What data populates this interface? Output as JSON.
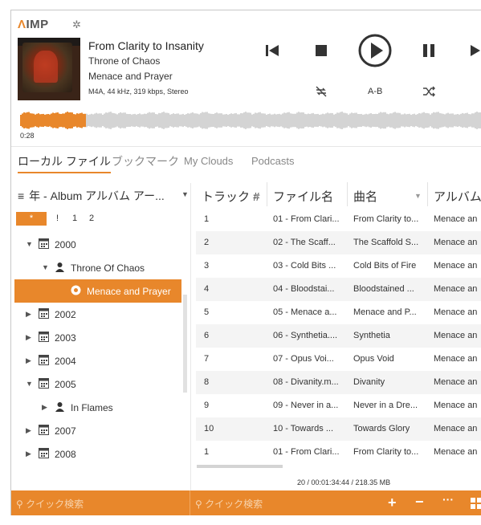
{
  "app": {
    "logo_prefix": "Λ",
    "logo_rest": "IMP"
  },
  "now_playing": {
    "title": "From Clarity to Insanity",
    "artist": "Throne of Chaos",
    "album": "Menace and Prayer",
    "format": "M4A, 44 kHz, 319 kbps, Stereo",
    "position": "0:28",
    "ab_label": "A-B",
    "progress": 0.14
  },
  "tabs": [
    "ローカル ファイル",
    "ブックマーク",
    "My Clouds",
    "Podcasts"
  ],
  "left_panel": {
    "grouping_label": "年 - Album アルバム アー...",
    "alpha": [
      "*",
      "!",
      "1",
      "2"
    ],
    "tree": [
      {
        "label": "2000",
        "type": "year",
        "expanded": true,
        "level": 0
      },
      {
        "label": "Throne Of Chaos",
        "type": "artist",
        "expanded": true,
        "level": 1
      },
      {
        "label": "Menace and Prayer",
        "type": "album",
        "selected": true,
        "level": 2
      },
      {
        "label": "2002",
        "type": "year",
        "expanded": false,
        "level": 0
      },
      {
        "label": "2003",
        "type": "year",
        "expanded": false,
        "level": 0
      },
      {
        "label": "2004",
        "type": "year",
        "expanded": false,
        "level": 0
      },
      {
        "label": "2005",
        "type": "year",
        "expanded": true,
        "level": 0
      },
      {
        "label": "In Flames",
        "type": "artist",
        "expanded": false,
        "level": 1
      },
      {
        "label": "2007",
        "type": "year",
        "expanded": false,
        "level": 0
      },
      {
        "label": "2008",
        "type": "year",
        "expanded": false,
        "level": 0
      }
    ]
  },
  "table": {
    "columns": [
      "トラック #",
      "ファイル名",
      "曲名",
      "アルバム"
    ],
    "rows": [
      [
        "1",
        "01 - From Clari...",
        "From Clarity to...",
        "Menace an"
      ],
      [
        "2",
        "02 - The Scaff...",
        "The Scaffold S...",
        "Menace an"
      ],
      [
        "3",
        "03 - Cold Bits ...",
        "Cold Bits of Fire",
        "Menace an"
      ],
      [
        "4",
        "04 - Bloodstai...",
        "Bloodstained ...",
        "Menace an"
      ],
      [
        "5",
        "05 - Menace a...",
        "Menace and P...",
        "Menace an"
      ],
      [
        "6",
        "06 - Synthetia....",
        "Synthetia",
        "Menace an"
      ],
      [
        "7",
        "07 - Opus Voi...",
        "Opus Void",
        "Menace an"
      ],
      [
        "8",
        "08 - Divanity.m...",
        "Divanity",
        "Menace an"
      ],
      [
        "9",
        "09 - Never in a...",
        "Never in a Dre...",
        "Menace an"
      ],
      [
        "10",
        "10 - Towards ...",
        "Towards Glory",
        "Menace an"
      ],
      [
        "1",
        "01 - From Clari...",
        "From Clarity to...",
        "Menace an"
      ]
    ],
    "status": "20 / 00:01:34:44 / 218.35 MB"
  },
  "bottom": {
    "search_left": "クイック検索",
    "search_right": "クイック検索"
  },
  "colors": {
    "accent": "#e8872b"
  }
}
